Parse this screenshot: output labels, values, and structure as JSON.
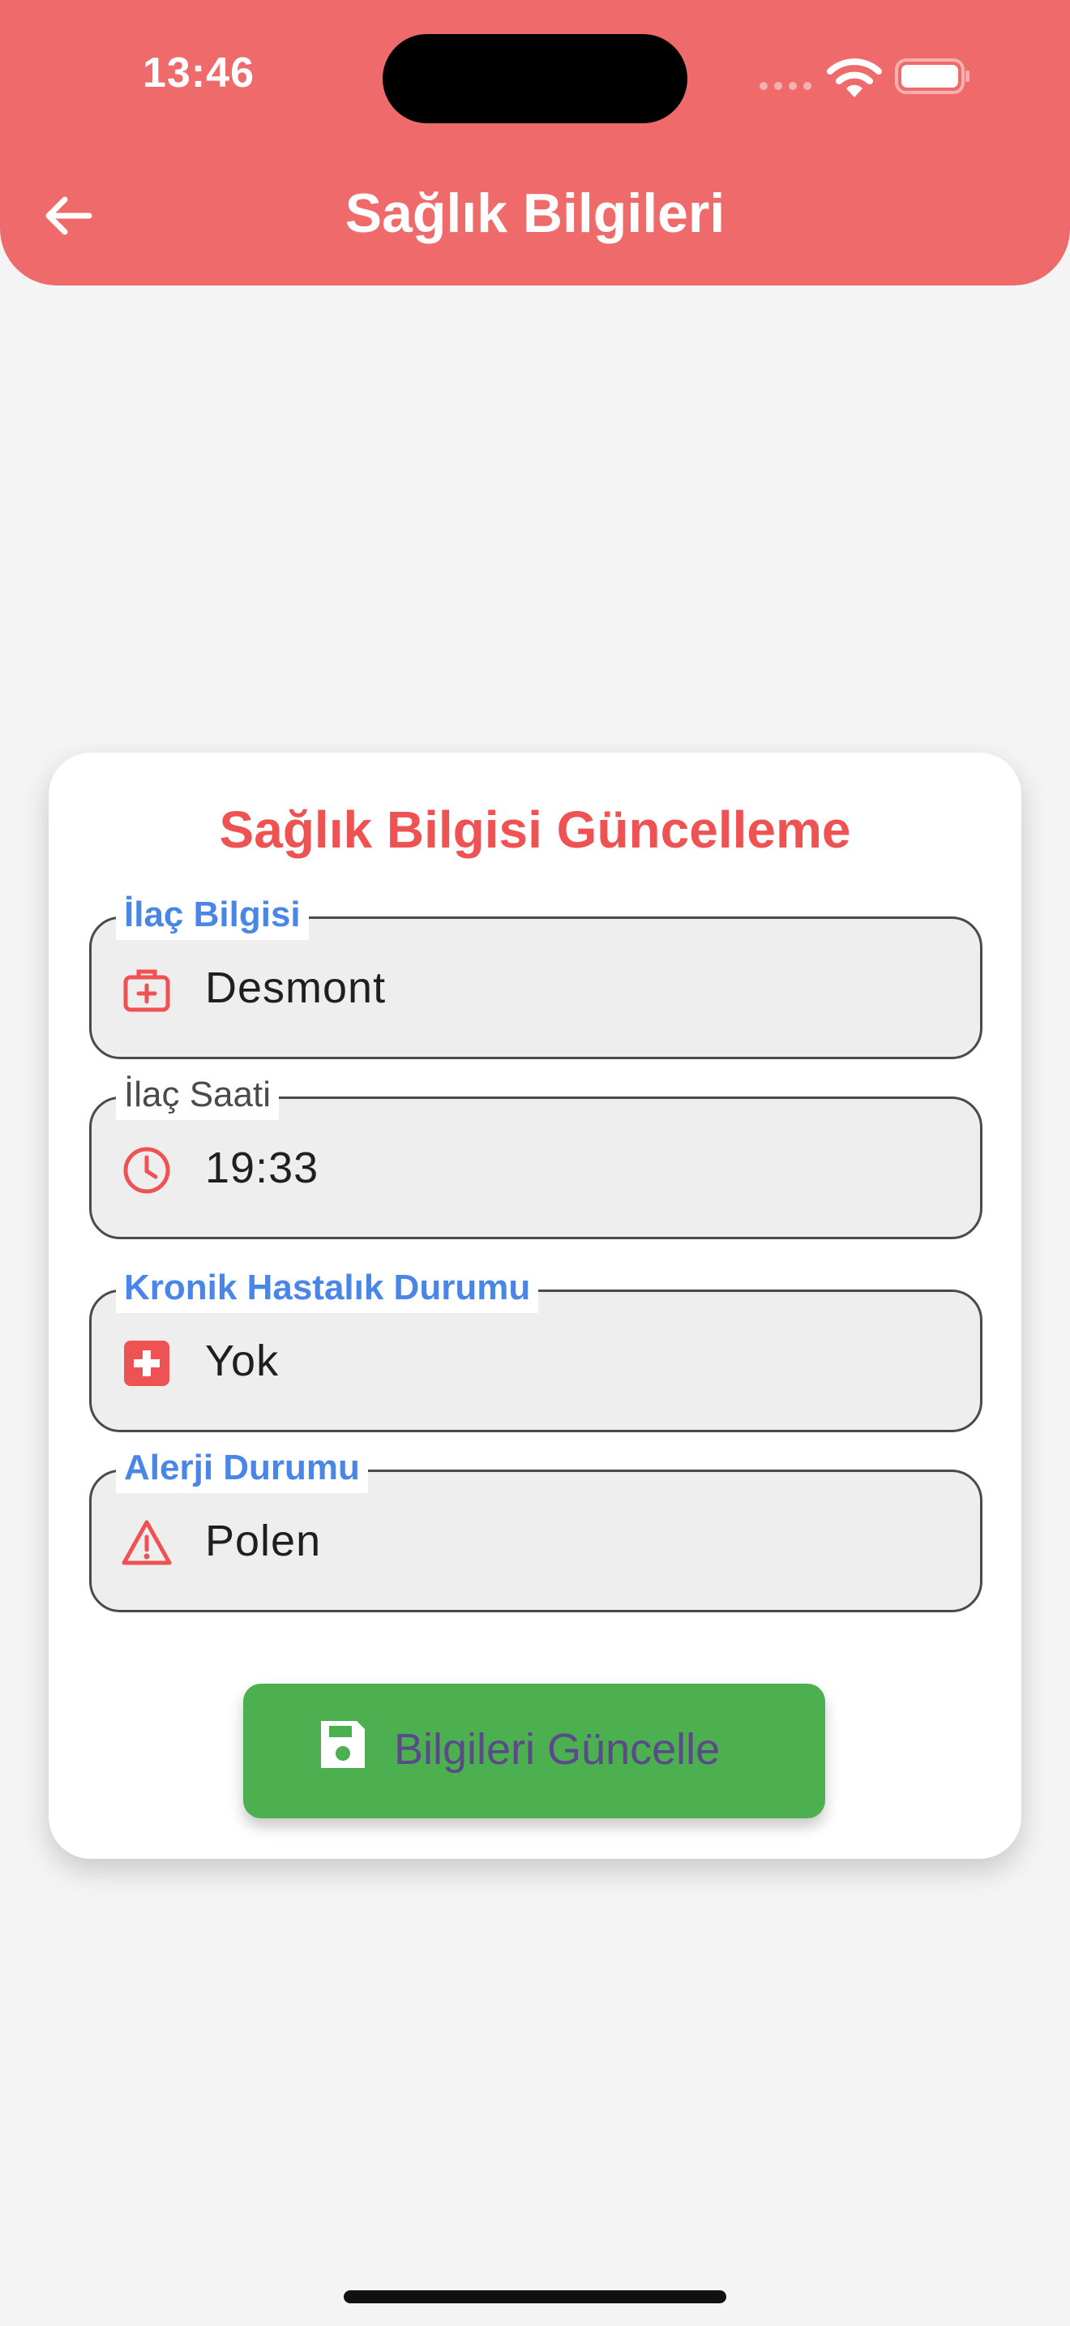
{
  "status_bar": {
    "time": "13:46"
  },
  "header": {
    "title": "Sağlık Bilgileri",
    "back_icon": "arrow-left-icon",
    "background_color": "#ef6b6b"
  },
  "card": {
    "title": "Sağlık Bilgisi Güncelleme",
    "fields": [
      {
        "label": "İlaç Bilgisi",
        "value": "Desmont",
        "icon": "medical-bag-icon"
      },
      {
        "label": "İlaç Saati",
        "value": "19:33",
        "icon": "clock-icon"
      },
      {
        "label": "Kronik Hastalık Durumu",
        "value": "Yok",
        "icon": "medical-cross-icon"
      },
      {
        "label": "Alerji Durumu",
        "value": "Polen",
        "icon": "warning-icon"
      }
    ],
    "save_button": {
      "label": "Bilgileri Güncelle",
      "icon": "save-icon",
      "color": "#4caf50"
    }
  },
  "colors": {
    "accent_red": "#ee5252",
    "label_blue": "#4a86e8"
  }
}
